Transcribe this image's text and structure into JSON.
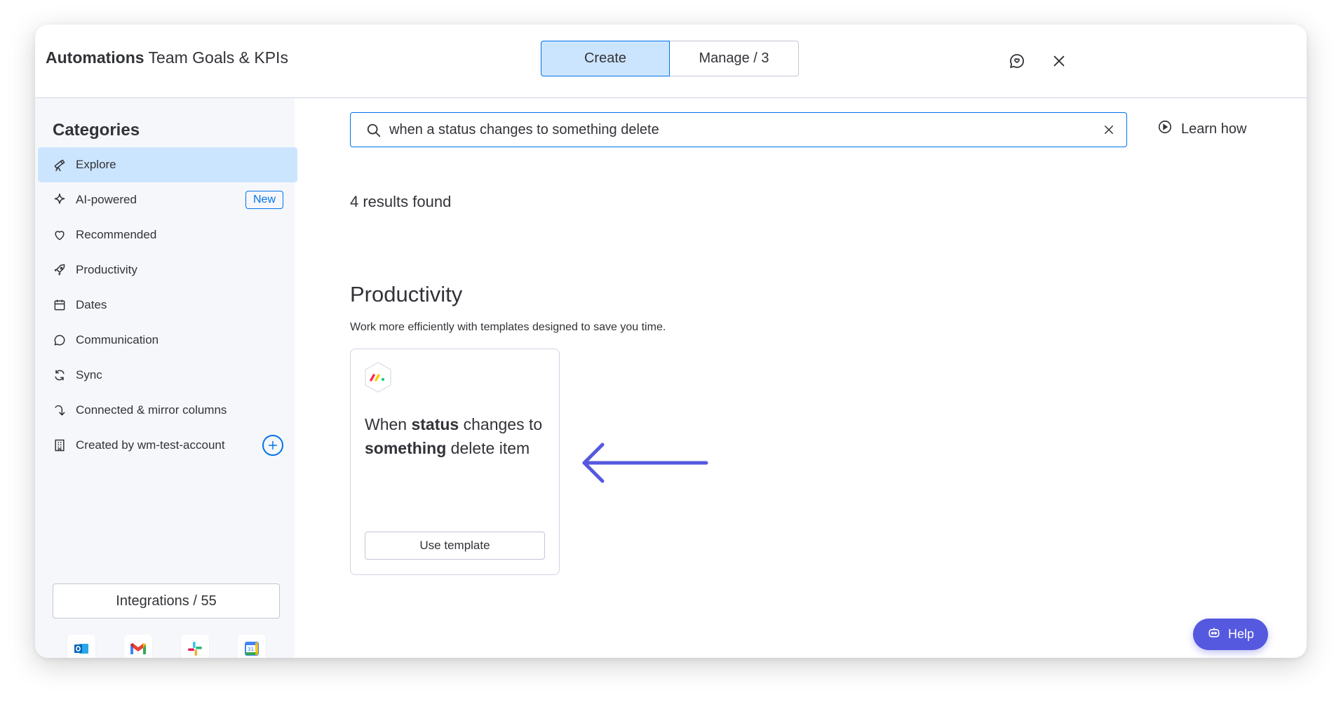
{
  "header": {
    "title_bold": "Automations",
    "title_rest": " Team Goals & KPIs",
    "tabs": [
      {
        "label": "Create",
        "active": true
      },
      {
        "label": "Manage / 3",
        "active": false
      }
    ],
    "icons": [
      "feedback-icon",
      "close-icon"
    ]
  },
  "sidebar": {
    "title": "Categories",
    "items": [
      {
        "label": "Explore",
        "icon": "telescope-icon",
        "active": true
      },
      {
        "label": "AI-powered",
        "icon": "sparkle-icon",
        "badge": "New"
      },
      {
        "label": "Recommended",
        "icon": "heart-icon"
      },
      {
        "label": "Productivity",
        "icon": "rocket-icon"
      },
      {
        "label": "Dates",
        "icon": "calendar-icon"
      },
      {
        "label": "Communication",
        "icon": "chat-bubble-icon"
      },
      {
        "label": "Sync",
        "icon": "sync-icon"
      },
      {
        "label": "Connected & mirror columns",
        "icon": "connect-icon"
      },
      {
        "label": "Created by wm-test-account",
        "icon": "building-icon",
        "action": "plus-icon"
      }
    ],
    "integrations_label": "Integrations / 55",
    "apps": [
      "outlook-icon",
      "gmail-icon",
      "slack-icon",
      "google-calendar-icon"
    ]
  },
  "search": {
    "value": "when a status changes to something delete"
  },
  "learn_how": "Learn how",
  "results_text": "4 results found",
  "section": {
    "title": "Productivity",
    "subtitle": "Work more efficiently with templates designed to save you time."
  },
  "card": {
    "w1": "When ",
    "b1": "status",
    "w2": " changes to ",
    "b2": "something",
    "w3": " delete item",
    "button": "Use template"
  },
  "help_label": "Help",
  "colors": {
    "primary": "#0073ea",
    "selected_bg": "#cce5ff",
    "sidebar_bg": "#f6f7fb",
    "help_bg": "#5559df",
    "arrow": "#5559df"
  }
}
